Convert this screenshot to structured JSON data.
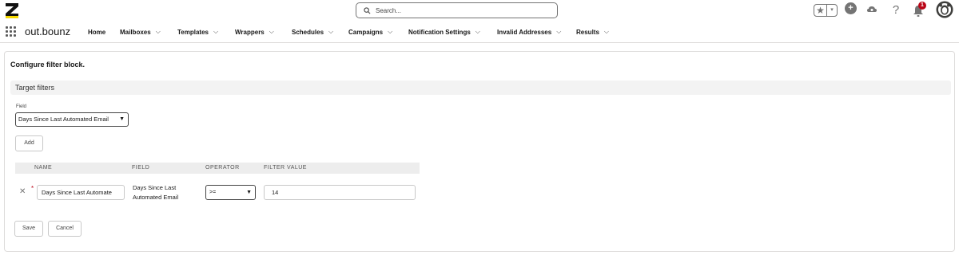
{
  "header": {
    "search_placeholder": "Search...",
    "notification_count": "1"
  },
  "nav": {
    "app_name": "out.bounz",
    "items": [
      {
        "label": "Home",
        "has_menu": false
      },
      {
        "label": "Mailboxes",
        "has_menu": true
      },
      {
        "label": "Templates",
        "has_menu": true
      },
      {
        "label": "Wrappers",
        "has_menu": true
      },
      {
        "label": "Schedules",
        "has_menu": true
      },
      {
        "label": "Campaigns",
        "has_menu": true
      },
      {
        "label": "Notification Settings",
        "has_menu": true
      },
      {
        "label": "Invalid Addresses",
        "has_menu": true
      },
      {
        "label": "Results",
        "has_menu": true
      }
    ]
  },
  "page": {
    "title": "Configure filter block.",
    "section_title": "Target filters",
    "field_label": "Field",
    "field_value": "Days Since Last Automated Email",
    "add_label": "Add",
    "table": {
      "headers": [
        "NAME",
        "FIELD",
        "OPERATOR",
        "FILTER VALUE"
      ],
      "rows": [
        {
          "name": "Days Since Last Automate",
          "field_line1": "Days Since Last",
          "field_line2": "Automated Email",
          "operator": ">=",
          "filter_value": "14"
        }
      ]
    },
    "save_label": "Save",
    "cancel_label": "Cancel"
  },
  "colors": {
    "required": "#ba0517",
    "header_bg": "#ededed",
    "section_bg": "#f3f3f3",
    "logo_accent": "#f5d800"
  },
  "icons": [
    "logo-icon",
    "search-icon",
    "favorites-star-icon",
    "chevron-down-icon",
    "add-icon",
    "cloud-setup-icon",
    "help-icon",
    "bell-icon",
    "avatar-icon",
    "app-launcher-icon",
    "close-icon"
  ]
}
